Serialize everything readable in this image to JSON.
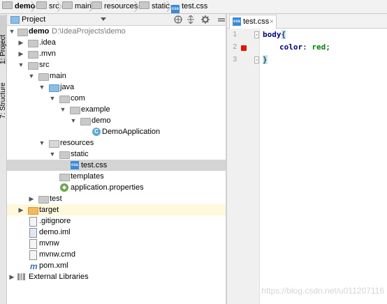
{
  "breadcrumb": [
    "demo",
    "src",
    "main",
    "resources",
    "static",
    "test.css"
  ],
  "side_tabs": {
    "project": "1: Project",
    "structure": "7: Structure"
  },
  "panel": {
    "title": "Project"
  },
  "tree": [
    {
      "label": "demo",
      "path": "D:\\IdeaProjects\\demo",
      "icon": "module-folder-icon"
    },
    {
      "label": ".idea",
      "icon": "folder-icon"
    },
    {
      "label": ".mvn",
      "icon": "folder-icon"
    },
    {
      "label": "src",
      "icon": "folder-icon"
    },
    {
      "label": "main",
      "icon": "folder-icon"
    },
    {
      "label": "java",
      "icon": "source-folder-icon"
    },
    {
      "label": "com",
      "icon": "package-icon"
    },
    {
      "label": "example",
      "icon": "package-icon"
    },
    {
      "label": "demo",
      "icon": "package-icon"
    },
    {
      "label": "DemoApplication",
      "icon": "spring-class-icon"
    },
    {
      "label": "resources",
      "icon": "resources-folder-icon"
    },
    {
      "label": "static",
      "icon": "folder-icon"
    },
    {
      "label": "test.css",
      "icon": "css-file-icon"
    },
    {
      "label": "templates",
      "icon": "folder-icon"
    },
    {
      "label": "application.properties",
      "icon": "properties-file-icon"
    },
    {
      "label": "test",
      "icon": "folder-icon"
    },
    {
      "label": "target",
      "icon": "excluded-folder-icon"
    },
    {
      "label": ".gitignore",
      "icon": "text-file-icon"
    },
    {
      "label": "demo.iml",
      "icon": "iml-file-icon"
    },
    {
      "label": "mvnw",
      "icon": "text-file-icon"
    },
    {
      "label": "mvnw.cmd",
      "icon": "text-file-icon"
    },
    {
      "label": "pom.xml",
      "icon": "maven-icon"
    },
    {
      "label": "External Libraries",
      "icon": "libraries-icon"
    }
  ],
  "editor": {
    "tab": "test.css",
    "line_numbers": [
      "1",
      "2",
      "3"
    ],
    "code": {
      "selector": "body",
      "open_brace": "{",
      "property": "color",
      "colon": ":",
      "value": "red",
      "semicolon": ";",
      "close_brace": "}"
    }
  },
  "colors": {
    "selector": "#000080",
    "property": "#000080",
    "value": "#008000",
    "breakpoint": "#e51400"
  },
  "watermark": "https://blog.csdn.net/u011207116"
}
